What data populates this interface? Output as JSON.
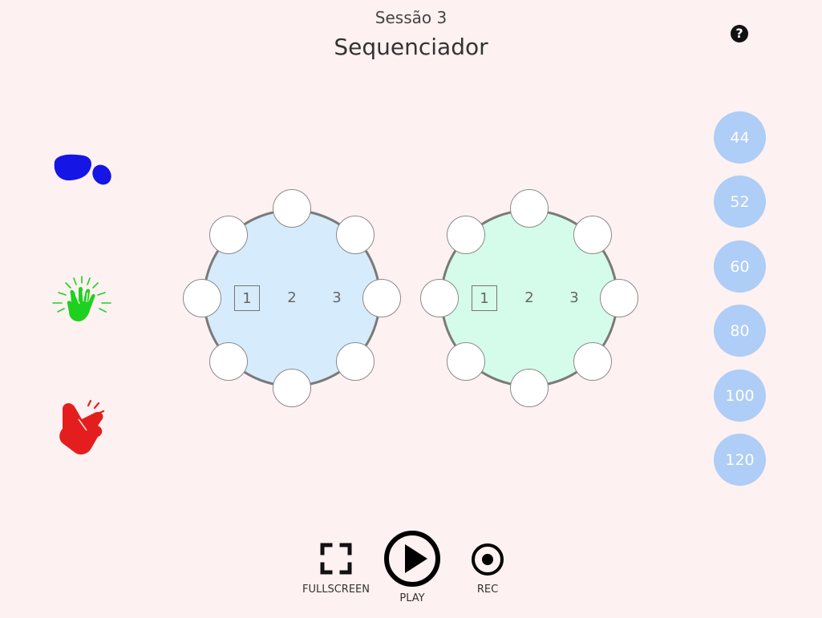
{
  "header": {
    "session": "Sessão 3",
    "title": "Sequenciador",
    "help_glyph": "?"
  },
  "instruments": [
    {
      "name": "foot-stomp",
      "icon": "footprint-icon",
      "color": "#1515e6"
    },
    {
      "name": "clap",
      "icon": "clapping-hands-icon",
      "color": "#1fd11f"
    },
    {
      "name": "snap",
      "icon": "finger-snap-icon",
      "color": "#e41e1e"
    }
  ],
  "tempo": {
    "options": [
      "44",
      "52",
      "60",
      "80",
      "100",
      "120"
    ],
    "button_color": "#aecdf7"
  },
  "sequencers": [
    {
      "fill": "#d6ebfb",
      "beats": [
        "1",
        "2",
        "3"
      ],
      "selected_beat": "1",
      "slot_count": 8
    },
    {
      "fill": "#d5fbea",
      "beats": [
        "1",
        "2",
        "3"
      ],
      "selected_beat": "1",
      "slot_count": 8
    }
  ],
  "controls": {
    "fullscreen_label": "FULLSCREEN",
    "play_label": "PLAY",
    "rec_label": "REC"
  }
}
